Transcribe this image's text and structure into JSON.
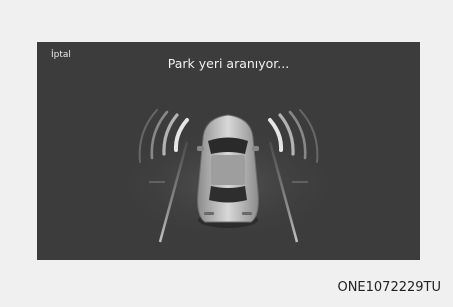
{
  "screen": {
    "cancel_label": "İptal",
    "title": "Park yeri aranıyor..."
  },
  "caption": "ONE1072229TU",
  "colors": {
    "background": "#f0f0f0",
    "screen": "#3c3c3c",
    "text": "#f2f2f2",
    "car_body": "#bdbdbd"
  }
}
